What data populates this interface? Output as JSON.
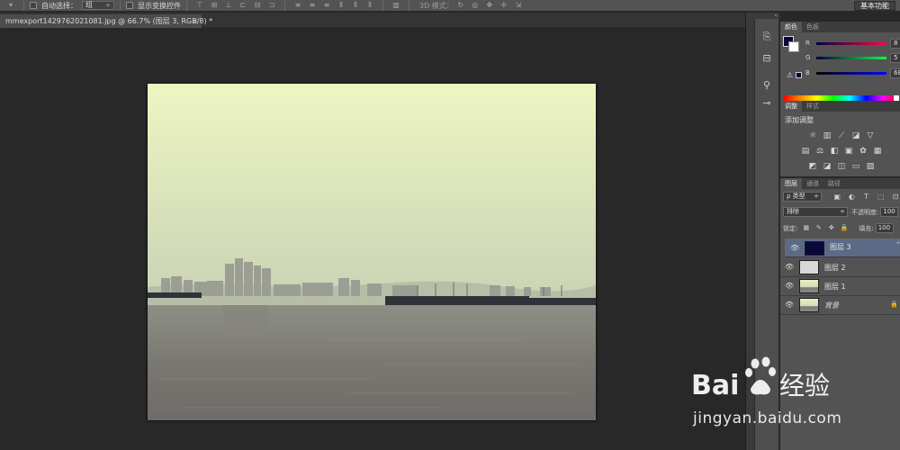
{
  "options_bar": {
    "auto_select_label": "自动选择：",
    "auto_select_value": "组",
    "show_transform_label": "显示变换控件",
    "mode_3d_label": "3D 模式：",
    "workspace_label": "基本功能"
  },
  "document": {
    "tab_title": "mmexport1429762021081.jpg @ 66.7% (图层 3, RGB/8) *",
    "close_glyph": "×"
  },
  "color_panel": {
    "tabs": [
      "颜色",
      "色板"
    ],
    "r_label": "R",
    "g_label": "G",
    "b_label": "B",
    "r_value": "8",
    "g_value": "5",
    "b_value": "68",
    "fg_color": "#08053c",
    "bg_color": "#ffffff"
  },
  "adjust_panel": {
    "tabs": [
      "调整",
      "样式"
    ],
    "title": "添加调整"
  },
  "layers_panel": {
    "tabs": [
      "图层",
      "通道",
      "路径"
    ],
    "kind_label": "ρ 类型",
    "blend_mode": "排除",
    "opacity_label": "不透明度:",
    "opacity_value": "100",
    "lock_label": "锁定:",
    "fill_label": "填充:",
    "fill_value": "100",
    "layers": [
      {
        "name": "图层 3",
        "selected": true,
        "thumb": "#0a0838"
      },
      {
        "name": "图层 2",
        "selected": false,
        "thumb": "#d7d7d7"
      },
      {
        "name": "图层 1",
        "selected": false,
        "thumb": "photo"
      },
      {
        "name": "背景",
        "selected": false,
        "thumb": "photo",
        "italic": true,
        "locked": true
      }
    ]
  },
  "watermark": {
    "brand": "Bai 经验",
    "url": "jingyan.baidu.com"
  }
}
